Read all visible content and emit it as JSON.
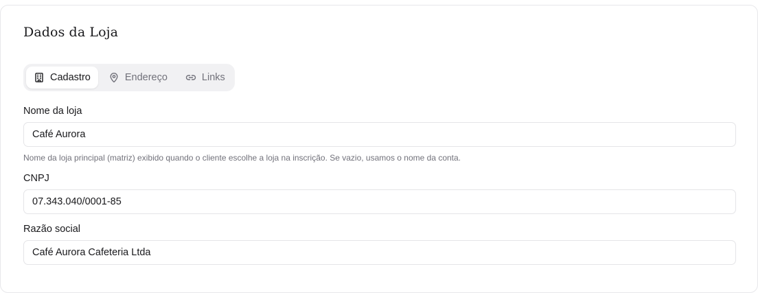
{
  "card": {
    "title": "Dados da Loja"
  },
  "tabs": [
    {
      "label": "Cadastro",
      "icon": "building-icon",
      "active": true
    },
    {
      "label": "Endereço",
      "icon": "map-pin-icon",
      "active": false
    },
    {
      "label": "Links",
      "icon": "link-icon",
      "active": false
    }
  ],
  "fields": {
    "store_name": {
      "label": "Nome da loja",
      "value": "Café Aurora",
      "help": "Nome da loja principal (matriz) exibido quando o cliente escolhe a loja na inscrição. Se vazio, usamos o nome da conta."
    },
    "cnpj": {
      "label": "CNPJ",
      "value": "07.343.040/0001-85"
    },
    "legal_name": {
      "label": "Razão social",
      "value": "Café Aurora Cafeteria Ltda"
    }
  },
  "colors": {
    "tab_bar_bg": "#f1f1f3",
    "active_tab_bg": "#ffffff",
    "inactive_text": "#71717a",
    "primary_text": "#18181b",
    "input_border": "#e4e4e7"
  }
}
